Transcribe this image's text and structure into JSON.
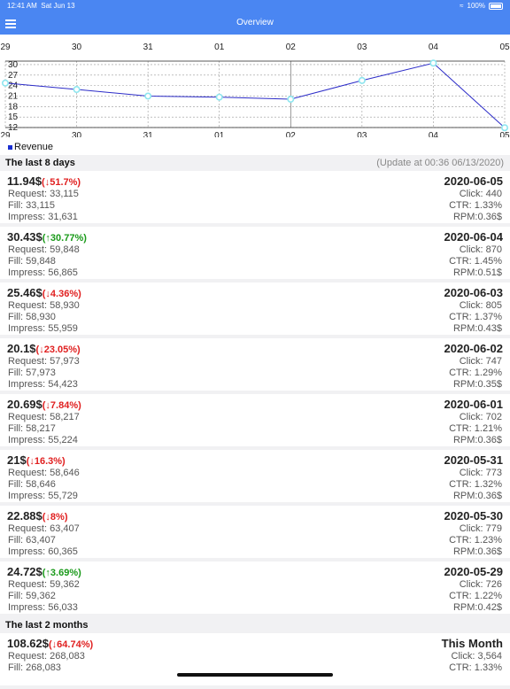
{
  "status_bar": {
    "time": "12:41 AM",
    "date": "Sat Jun 13",
    "battery": "100%"
  },
  "nav": {
    "title": "Overview"
  },
  "chart_data": {
    "type": "line",
    "x": [
      "29",
      "30",
      "31",
      "01",
      "02",
      "03",
      "04",
      "05"
    ],
    "series": [
      {
        "name": "Revenue",
        "values": [
          24.72,
          22.88,
          21,
          20.69,
          20.1,
          25.46,
          30.43,
          11.94
        ]
      }
    ],
    "yticks": [
      12,
      15,
      18,
      21,
      24,
      27,
      30
    ],
    "ylim": [
      12,
      31
    ],
    "color": "#2c2cc8",
    "marker_color": "#8ee6ef",
    "grid": true,
    "legend": "bottom-left"
  },
  "sections": [
    {
      "title": "The last 8 days",
      "update": "(Update at 00:36 06/13/2020)"
    }
  ],
  "rows": [
    {
      "value": "11.94$",
      "change": "(↓51.7%)",
      "dir": "down",
      "date": "2020-06-05",
      "request": "Request: 33,115",
      "fill": "Fill: 33,115",
      "impress": "Impress: 31,631",
      "click": "Click: 440",
      "ctr": "CTR: 1.33%",
      "rpm": "RPM:0.36$"
    },
    {
      "value": "30.43$",
      "change": "(↑30.77%)",
      "dir": "up",
      "date": "2020-06-04",
      "request": "Request: 59,848",
      "fill": "Fill: 59,848",
      "impress": "Impress: 56,865",
      "click": "Click: 870",
      "ctr": "CTR: 1.45%",
      "rpm": "RPM:0.51$"
    },
    {
      "value": "25.46$",
      "change": "(↓4.36%)",
      "dir": "down",
      "date": "2020-06-03",
      "request": "Request: 58,930",
      "fill": "Fill: 58,930",
      "impress": "Impress: 55,959",
      "click": "Click: 805",
      "ctr": "CTR: 1.37%",
      "rpm": "RPM:0.43$"
    },
    {
      "value": "20.1$",
      "change": "(↓23.05%)",
      "dir": "down",
      "date": "2020-06-02",
      "request": "Request: 57,973",
      "fill": "Fill: 57,973",
      "impress": "Impress: 54,423",
      "click": "Click: 747",
      "ctr": "CTR: 1.29%",
      "rpm": "RPM:0.35$"
    },
    {
      "value": "20.69$",
      "change": "(↓7.84%)",
      "dir": "down",
      "date": "2020-06-01",
      "request": "Request: 58,217",
      "fill": "Fill: 58,217",
      "impress": "Impress: 55,224",
      "click": "Click: 702",
      "ctr": "CTR: 1.21%",
      "rpm": "RPM:0.36$"
    },
    {
      "value": "21$",
      "change": "(↓16.3%)",
      "dir": "down",
      "date": "2020-05-31",
      "request": "Request: 58,646",
      "fill": "Fill: 58,646",
      "impress": "Impress: 55,729",
      "click": "Click: 773",
      "ctr": "CTR: 1.32%",
      "rpm": "RPM:0.36$"
    },
    {
      "value": "22.88$",
      "change": "(↓8%)",
      "dir": "down",
      "date": "2020-05-30",
      "request": "Request: 63,407",
      "fill": "Fill: 63,407",
      "impress": "Impress: 60,365",
      "click": "Click: 779",
      "ctr": "CTR: 1.23%",
      "rpm": "RPM:0.36$"
    },
    {
      "value": "24.72$",
      "change": "(↑3.69%)",
      "dir": "up",
      "date": "2020-05-29",
      "request": "Request: 59,362",
      "fill": "Fill: 59,362",
      "impress": "Impress: 56,033",
      "click": "Click: 726",
      "ctr": "CTR: 1.22%",
      "rpm": "RPM:0.42$"
    }
  ],
  "section2": {
    "title": "The last 2 months"
  },
  "month_row": {
    "value": "108.62$",
    "change": "(↓64.74%)",
    "dir": "down",
    "date": "This Month",
    "request": "Request: 268,083",
    "fill": "Fill: 268,083",
    "click": "Click: 3,564",
    "ctr": "CTR: 1.33%"
  }
}
